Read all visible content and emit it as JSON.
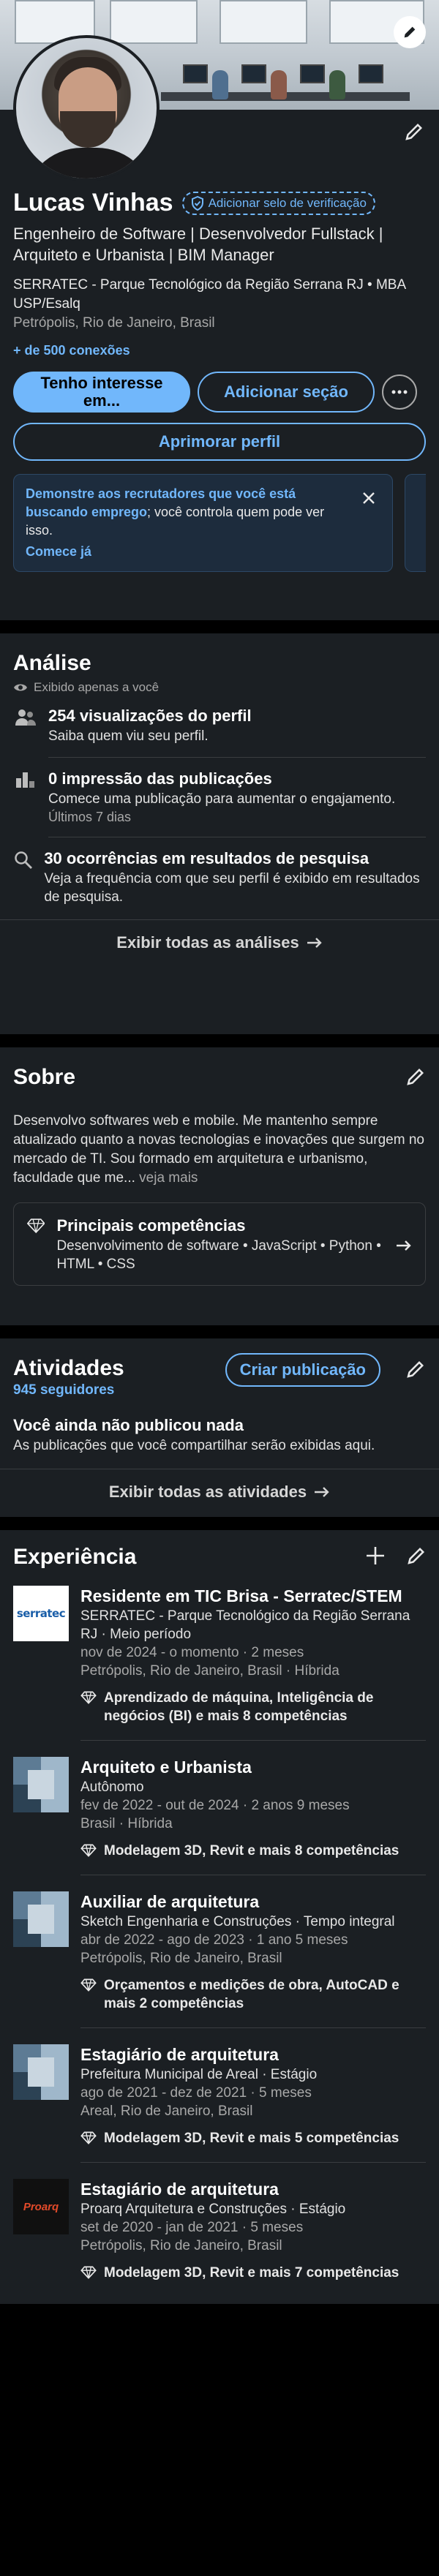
{
  "profile": {
    "name": "Lucas Vinhas",
    "verify_label": "Adicionar selo de verificação",
    "headline": "Engenheiro de Software | Desenvolvedor Fullstack | Arquiteto e Urbanista | BIM Manager",
    "org": "SERRATEC - Parque Tecnológico da Região Serrana RJ • MBA USP/Esalq",
    "location": "Petrópolis, Rio de Janeiro, Brasil",
    "connections": "+ de 500 conexões",
    "buttons": {
      "interest": "Tenho interesse em...",
      "add_section": "Adicionar seção",
      "improve": "Aprimorar perfil"
    },
    "tip": {
      "highlight": "Demonstre aos recrutadores que você está buscando emprego",
      "rest": "; você controla quem pode ver isso.",
      "link": "Comece já"
    }
  },
  "analytics": {
    "title": "Análise",
    "private_label": "Exibido apenas a você",
    "items": [
      {
        "title": "254 visualizações do perfil",
        "sub": "Saiba quem viu seu perfil.",
        "note": ""
      },
      {
        "title": "0 impressão das publicações",
        "sub": "Comece uma publicação para aumentar o engajamento.",
        "note": "Últimos 7 dias"
      },
      {
        "title": "30 ocorrências em resultados de pesquisa",
        "sub": "Veja a frequência com que seu perfil é exibido em resultados de pesquisa.",
        "note": ""
      }
    ],
    "see_all": "Exibir todas as análises"
  },
  "about": {
    "title": "Sobre",
    "text": "Desenvolvo softwares web e mobile. Me mantenho sempre atualizado quanto a novas tecnologias e inovações que surgem no mercado de TI. Sou formado em arquitetura e urbanismo, faculdade que me...",
    "more": "veja mais",
    "skills_title": "Principais competências",
    "skills_list": "Desenvolvimento de software • JavaScript • Python • HTML • CSS"
  },
  "activity": {
    "title": "Atividades",
    "followers": "945 seguidores",
    "create_post": "Criar publicação",
    "empty_title": "Você ainda não publicou nada",
    "empty_sub": "As publicações que você compartilhar serão exibidas aqui.",
    "see_all": "Exibir todas as atividades"
  },
  "experience": {
    "title": "Experiência",
    "items": [
      {
        "logo": "serratec",
        "logo_text": "serratec",
        "title": "Residente em TIC Brisa - Serratec/STEM",
        "company": "SERRATEC - Parque Tecnológico da Região Serrana RJ · Meio período",
        "dates": "nov de 2024 - o momento · 2 meses",
        "place": "Petrópolis, Rio de Janeiro, Brasil · Híbrida",
        "skills": "Aprendizado de máquina, Inteligência de negócios (BI) e mais 8 competências"
      },
      {
        "logo": "generic",
        "logo_text": "",
        "title": "Arquiteto e Urbanista",
        "company": "Autônomo",
        "dates": "fev de 2022 - out de 2024 · 2 anos 9 meses",
        "place": "Brasil · Híbrida",
        "skills": "Modelagem 3D, Revit e mais 8 competências"
      },
      {
        "logo": "generic",
        "logo_text": "",
        "title": "Auxiliar de arquitetura",
        "company": "Sketch Engenharia e Construções · Tempo integral",
        "dates": "abr de 2022 - ago de 2023 · 1 ano 5 meses",
        "place": "Petrópolis, Rio de Janeiro, Brasil",
        "skills": "Orçamentos e medições de obra, AutoCAD e mais 2 competências"
      },
      {
        "logo": "generic",
        "logo_text": "",
        "title": "Estagiário de arquitetura",
        "company": "Prefeitura Municipal de Areal · Estágio",
        "dates": "ago de 2021 - dez de 2021 · 5 meses",
        "place": "Areal, Rio de Janeiro, Brasil",
        "skills": "Modelagem 3D, Revit e mais 5 competências"
      },
      {
        "logo": "proarq",
        "logo_text": "Proarq",
        "title": "Estagiário de arquitetura",
        "company": "Proarq Arquitetura e Construções · Estágio",
        "dates": "set de 2020 - jan de 2021 · 5 meses",
        "place": "Petrópolis, Rio de Janeiro, Brasil",
        "skills": "Modelagem 3D, Revit e mais 7 competências"
      }
    ]
  },
  "colors": {
    "accent": "#71b7fb",
    "card": "#1b1f23",
    "background": "#000000",
    "text": "#e9e9e9",
    "muted": "#a8a8a8"
  },
  "icons": [
    "pencil-icon",
    "verified-shield-icon",
    "eye-icon",
    "people-icon",
    "bar-chart-icon",
    "search-icon",
    "arrow-right-icon",
    "close-icon",
    "more-icon",
    "diamond-icon",
    "plus-icon"
  ]
}
